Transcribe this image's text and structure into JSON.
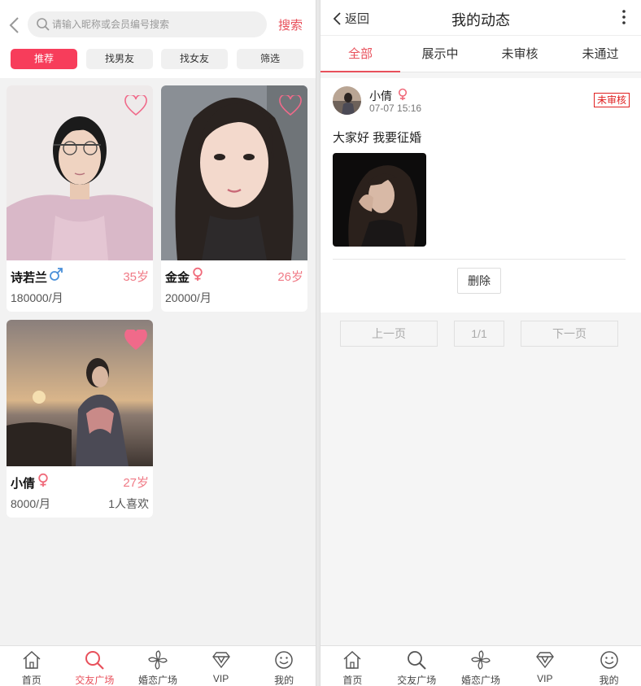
{
  "left": {
    "search": {
      "placeholder": "请输入昵称或会员编号搜索",
      "button": "搜索"
    },
    "filters": [
      "推荐",
      "找男友",
      "找女友",
      "筛选"
    ],
    "cards": [
      {
        "name": "诗若兰",
        "sex": "male",
        "age": "35岁",
        "salary": "180000/月",
        "likes": "",
        "liked": false
      },
      {
        "name": "金金",
        "sex": "female",
        "age": "26岁",
        "salary": "20000/月",
        "likes": "",
        "liked": false
      },
      {
        "name": "小倩",
        "sex": "female",
        "age": "27岁",
        "salary": "8000/月",
        "likes": "1人喜欢",
        "liked": true
      }
    ]
  },
  "right": {
    "header": {
      "back": "返回",
      "title": "我的动态"
    },
    "tabs": [
      "全部",
      "展示中",
      "未审核",
      "未通过"
    ],
    "post": {
      "name": "小倩",
      "time": "07-07 15:16",
      "status": "未审核",
      "text": "大家好 我要征婚",
      "delete": "删除"
    },
    "pager": {
      "prev": "上一页",
      "page": "1/1",
      "next": "下一页"
    }
  },
  "nav": [
    "首页",
    "交友广场",
    "婚恋广场",
    "VIP",
    "我的"
  ],
  "colors": {
    "accent": "#e8505b",
    "button_active": "#f73d5b",
    "age": "#f07a86",
    "male": "#4a90d9",
    "female": "#f06a7a"
  }
}
